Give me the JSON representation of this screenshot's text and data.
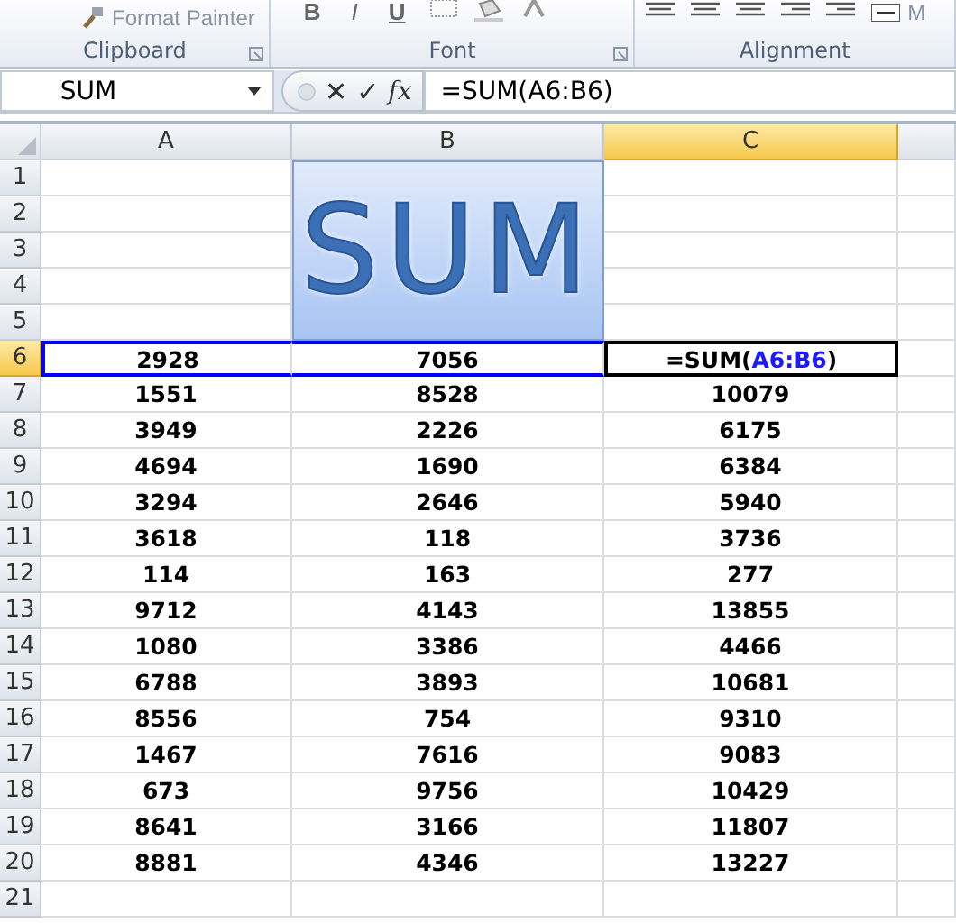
{
  "ribbon": {
    "groups": [
      {
        "label": "Clipboard",
        "items": [
          {
            "kind": "brush",
            "text": "Format Painter"
          }
        ]
      },
      {
        "label": "Font",
        "items": [
          {
            "kind": "char",
            "text": "B"
          },
          {
            "kind": "char",
            "text": "I"
          },
          {
            "kind": "char",
            "text": "U"
          },
          {
            "kind": "border"
          },
          {
            "kind": "fill"
          },
          {
            "kind": "fontcolor"
          }
        ]
      },
      {
        "label": "Alignment",
        "items": [
          {
            "kind": "align"
          },
          {
            "kind": "align"
          },
          {
            "kind": "align"
          },
          {
            "kind": "indent"
          },
          {
            "kind": "indent"
          },
          {
            "kind": "merge",
            "text": "M"
          }
        ]
      }
    ]
  },
  "formula_bar": {
    "name_box": "SUM",
    "cancel": "✕",
    "enter": "✓",
    "function": "fx",
    "formula": "=SUM(A6:B6)"
  },
  "sheet": {
    "columns": [
      {
        "label": "A",
        "selected": false
      },
      {
        "label": "B",
        "selected": false
      },
      {
        "label": "C",
        "selected": true
      }
    ],
    "word_art": {
      "text": "SUM"
    },
    "rows": [
      {
        "header": "1",
        "selected": false,
        "cells": []
      },
      {
        "header": "2",
        "selected": false,
        "cells": []
      },
      {
        "header": "3",
        "selected": false,
        "cells": []
      },
      {
        "header": "4",
        "selected": false,
        "cells": []
      },
      {
        "header": "5",
        "selected": false,
        "cells": []
      },
      {
        "header": "6",
        "selected": true,
        "cells": [
          {
            "text": "2928",
            "in_range": true
          },
          {
            "text": "7056",
            "in_range": true
          },
          {
            "active": true,
            "segments": [
              {
                "text": "=SUM("
              },
              {
                "text": "A6:B6",
                "kind": "ref"
              },
              {
                "text": ")"
              }
            ]
          }
        ]
      },
      {
        "header": "7",
        "selected": false,
        "cells": [
          "1551",
          "8528",
          "10079"
        ]
      },
      {
        "header": "8",
        "selected": false,
        "cells": [
          "3949",
          "2226",
          "6175"
        ]
      },
      {
        "header": "9",
        "selected": false,
        "cells": [
          "4694",
          "1690",
          "6384"
        ]
      },
      {
        "header": "10",
        "selected": false,
        "cells": [
          "3294",
          "2646",
          "5940"
        ]
      },
      {
        "header": "11",
        "selected": false,
        "cells": [
          "3618",
          "118",
          "3736"
        ]
      },
      {
        "header": "12",
        "selected": false,
        "cells": [
          "114",
          "163",
          "277"
        ]
      },
      {
        "header": "13",
        "selected": false,
        "cells": [
          "9712",
          "4143",
          "13855"
        ]
      },
      {
        "header": "14",
        "selected": false,
        "cells": [
          "1080",
          "3386",
          "4466"
        ]
      },
      {
        "header": "15",
        "selected": false,
        "cells": [
          "6788",
          "3893",
          "10681"
        ]
      },
      {
        "header": "16",
        "selected": false,
        "cells": [
          "8556",
          "754",
          "9310"
        ]
      },
      {
        "header": "17",
        "selected": false,
        "cells": [
          "1467",
          "7616",
          "9083"
        ]
      },
      {
        "header": "18",
        "selected": false,
        "cells": [
          "673",
          "9756",
          "10429"
        ]
      },
      {
        "header": "19",
        "selected": false,
        "cells": [
          "8641",
          "3166",
          "11807"
        ]
      },
      {
        "header": "20",
        "selected": false,
        "cells": [
          "8881",
          "4346",
          "13227"
        ]
      },
      {
        "header": "21",
        "selected": false,
        "cells": []
      }
    ]
  }
}
